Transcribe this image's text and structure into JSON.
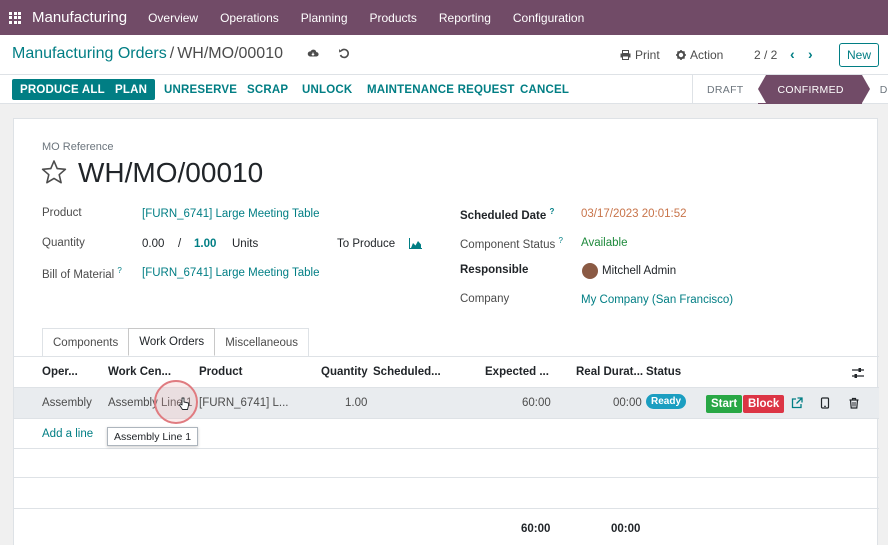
{
  "nav": {
    "app_name": "Manufacturing",
    "menus": [
      "Overview",
      "Operations",
      "Planning",
      "Products",
      "Reporting",
      "Configuration"
    ]
  },
  "control": {
    "breadcrumb_parent": "Manufacturing Orders",
    "breadcrumb_sep": "/",
    "breadcrumb_current": "WH/MO/00010",
    "print_label": "Print",
    "action_label": "Action",
    "pager": "2 / 2",
    "new_label": "New"
  },
  "statusbar": {
    "buttons": [
      "PRODUCE ALL",
      "PLAN",
      "UNRESERVE",
      "SCRAP",
      "UNLOCK",
      "MAINTENANCE REQUEST",
      "CANCEL"
    ],
    "stages": [
      "DRAFT",
      "CONFIRMED",
      "DONE"
    ],
    "active_stage": "CONFIRMED"
  },
  "form": {
    "ref_label": "MO Reference",
    "ref_value": "WH/MO/00010",
    "product_label": "Product",
    "product_value": "[FURN_6741] Large Meeting Table",
    "quantity_label": "Quantity",
    "qty_produced": "0.00",
    "qty_sep": "/",
    "qty_total": "1.00",
    "qty_uom": "Units",
    "to_produce_label": "To Produce",
    "bom_label": "Bill of Material",
    "bom_value": "[FURN_6741] Large Meeting Table",
    "scheduled_label": "Scheduled Date",
    "scheduled_value": "03/17/2023 20:01:52",
    "component_status_label": "Component Status",
    "component_status_value": "Available",
    "responsible_label": "Responsible",
    "responsible_value": "Mitchell Admin",
    "company_label": "Company",
    "company_value": "My Company (San Francisco)",
    "help_mark": "?"
  },
  "tabs": [
    "Components",
    "Work Orders",
    "Miscellaneous"
  ],
  "active_tab": "Work Orders",
  "workorders": {
    "columns": [
      "Oper...",
      "Work Cen...",
      "Product",
      "Quantity",
      "Scheduled...",
      "Expected ...",
      "Real Durat...",
      "Status"
    ],
    "rows": [
      {
        "operation": "Assembly",
        "work_center": "Assembly Line 1",
        "product": "[FURN_6741] L...",
        "quantity": "1.00",
        "scheduled": "",
        "expected": "60:00",
        "real": "00:00",
        "status": "Ready",
        "start_label": "Start",
        "block_label": "Block"
      }
    ],
    "add_line": "Add a line",
    "total_expected": "60:00",
    "total_real": "00:00"
  },
  "tooltip": "Assembly Line 1",
  "colors": {
    "brand": "#714b67",
    "accent": "#017e84",
    "ready": "#1b9ec1",
    "start": "#28a745",
    "block": "#dc3545"
  }
}
